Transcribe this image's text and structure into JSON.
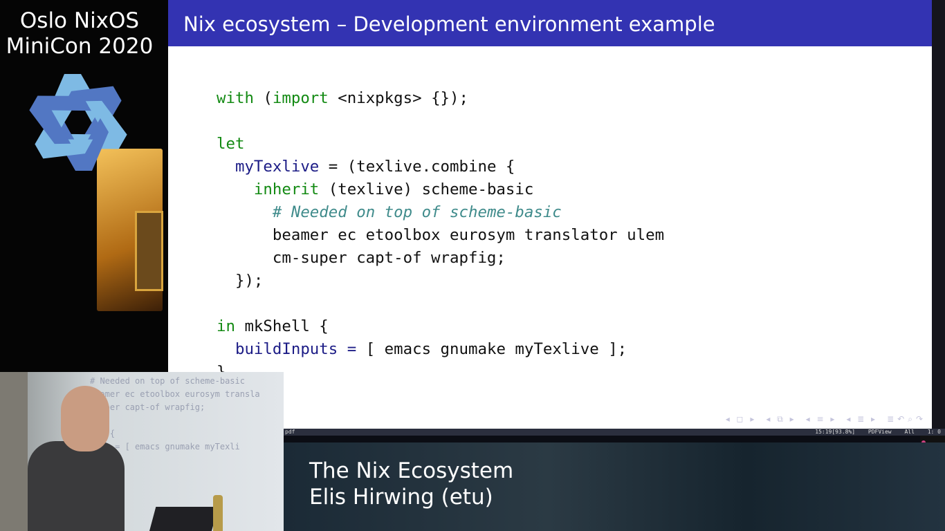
{
  "conference": {
    "line1": "Oslo NixOS",
    "line2": "MiniCon 2020"
  },
  "colors": {
    "slide_header": "#3333b2",
    "keyword": "#138a13",
    "identifier": "#1c1c86",
    "comment": "#3f8b8b",
    "logo_light": "#7ebae4",
    "logo_dark": "#5277c3"
  },
  "slide": {
    "title": "Nix ecosystem – Development environment example",
    "code_lines": [
      [
        [
          "kw",
          "with"
        ],
        [
          "t",
          " ("
        ],
        [
          "kw",
          "import"
        ],
        [
          "t",
          " <nixpkgs> {});"
        ]
      ],
      [],
      [
        [
          "kw",
          "let"
        ]
      ],
      [
        [
          "t",
          "  "
        ],
        [
          "id",
          "myTexlive"
        ],
        [
          "t",
          " = (texlive.combine {"
        ]
      ],
      [
        [
          "t",
          "    "
        ],
        [
          "kw",
          "inherit"
        ],
        [
          "t",
          " (texlive) scheme-basic"
        ]
      ],
      [
        [
          "t",
          "      "
        ],
        [
          "cm",
          "# Needed on top of scheme-basic"
        ]
      ],
      [
        [
          "t",
          "      beamer ec etoolbox eurosym translator ulem"
        ]
      ],
      [
        [
          "t",
          "      cm-super capt-of wrapfig;"
        ]
      ],
      [
        [
          "t",
          "  });"
        ]
      ],
      [],
      [
        [
          "kw",
          "in"
        ],
        [
          "t",
          " mkShell {"
        ]
      ],
      [
        [
          "t",
          "  "
        ],
        [
          "id",
          "buildInputs"
        ],
        [
          "t",
          " "
        ],
        [
          "id",
          "="
        ],
        [
          "t",
          " [ emacs gnumake myTexlive ];"
        ]
      ],
      [
        [
          "t",
          "}"
        ]
      ]
    ],
    "nav_icons": [
      "nav-frame-icon",
      "nav-subsection-icon",
      "nav-section-icon",
      "nav-document-icon",
      "nav-outline-icon",
      "nav-back-icon",
      "nav-search-icon",
      "nav-forward-icon"
    ]
  },
  "modeline": {
    "buffer": "pdf",
    "position": "15:19[93.8%]",
    "mode": "PDFView",
    "scope": "All",
    "page": "1:  0"
  },
  "talk": {
    "title": "The Nix Ecosystem",
    "speaker": "Elis Hirwing (etu)"
  },
  "camera": {
    "ghost_text": "# Needed on top of scheme-basic\nbeamer ec etoolbox eurosym transla\n-super capt-of wrapfig;\n\nell {\nputs = [ emacs gnumake myTexli"
  }
}
